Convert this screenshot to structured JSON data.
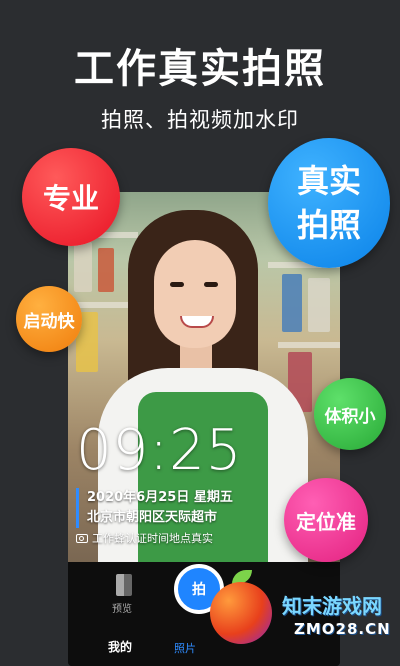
{
  "header": {
    "title": "工作真实拍照",
    "subtitle": "拍照、拍视频加水印"
  },
  "badges": {
    "pro": "专业",
    "real_line1": "真实",
    "real_line2": "拍照",
    "fast": "启动快",
    "small": "体积小",
    "location": "定位准"
  },
  "camera": {
    "time": "09:25",
    "date": "2020年6月25日 星期五",
    "location": "北京市朝阳区天际超市",
    "caption": "工作蜂认证时间地点真实",
    "preview_label": "预览",
    "shutter_label": "拍",
    "tab_me": "我的",
    "tab_photo": "照片"
  },
  "watermark": {
    "name": "知末游戏网",
    "url": "ZMO28.CN"
  },
  "colors": {
    "background": "#2b2d30",
    "accent_blue": "#1f85ff",
    "red": "#e81224",
    "orange": "#f07d0c",
    "green": "#28a936",
    "pink": "#e3207f"
  }
}
